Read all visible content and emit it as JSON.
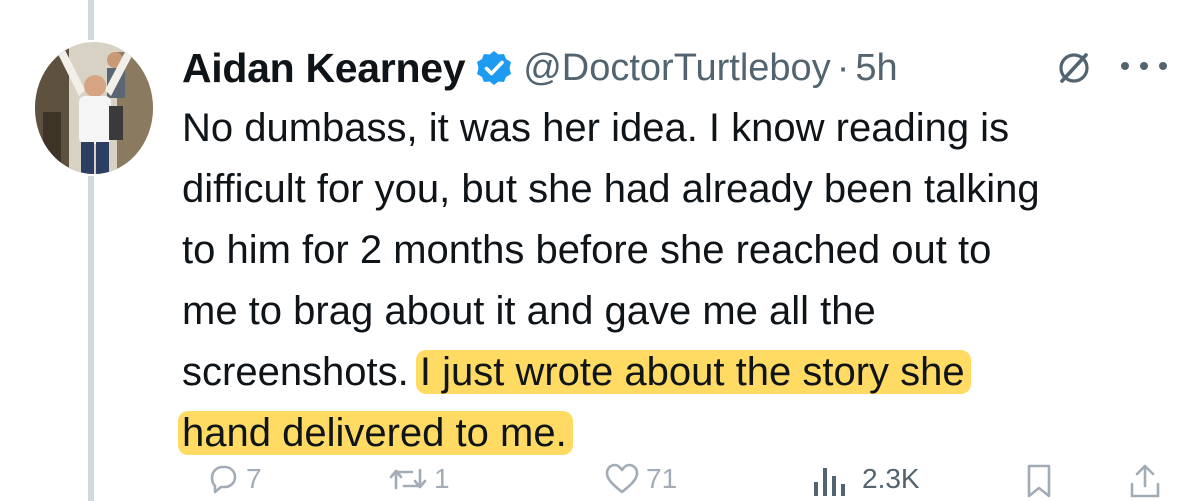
{
  "tweet": {
    "author_name": "Aidan Kearney",
    "handle": "@DoctorTurtleboy",
    "separator": "·",
    "time": "5h",
    "verified_color": "#1d9bf0",
    "body_lines": [
      "No dumbass, it was her idea. I know reading is",
      "difficult for you, but she had already been talking",
      "to him for 2 months before she reached out to",
      "me to brag about it and gave me all the"
    ],
    "line5_plain": "screenshots. ",
    "line5_highlight": "I just wrote about the story she",
    "line6_highlight": "hand delivered to me.",
    "highlight_color": "#ffcd28"
  },
  "actions": {
    "replies": "7",
    "reposts": "1",
    "likes": "71",
    "views": "2.3K"
  },
  "icons": {
    "grok": "grok-icon",
    "more": "more-icon",
    "reply": "reply-icon",
    "repost": "repost-icon",
    "like": "like-icon",
    "views": "views-icon",
    "bookmark": "bookmark-icon",
    "share": "share-icon"
  }
}
